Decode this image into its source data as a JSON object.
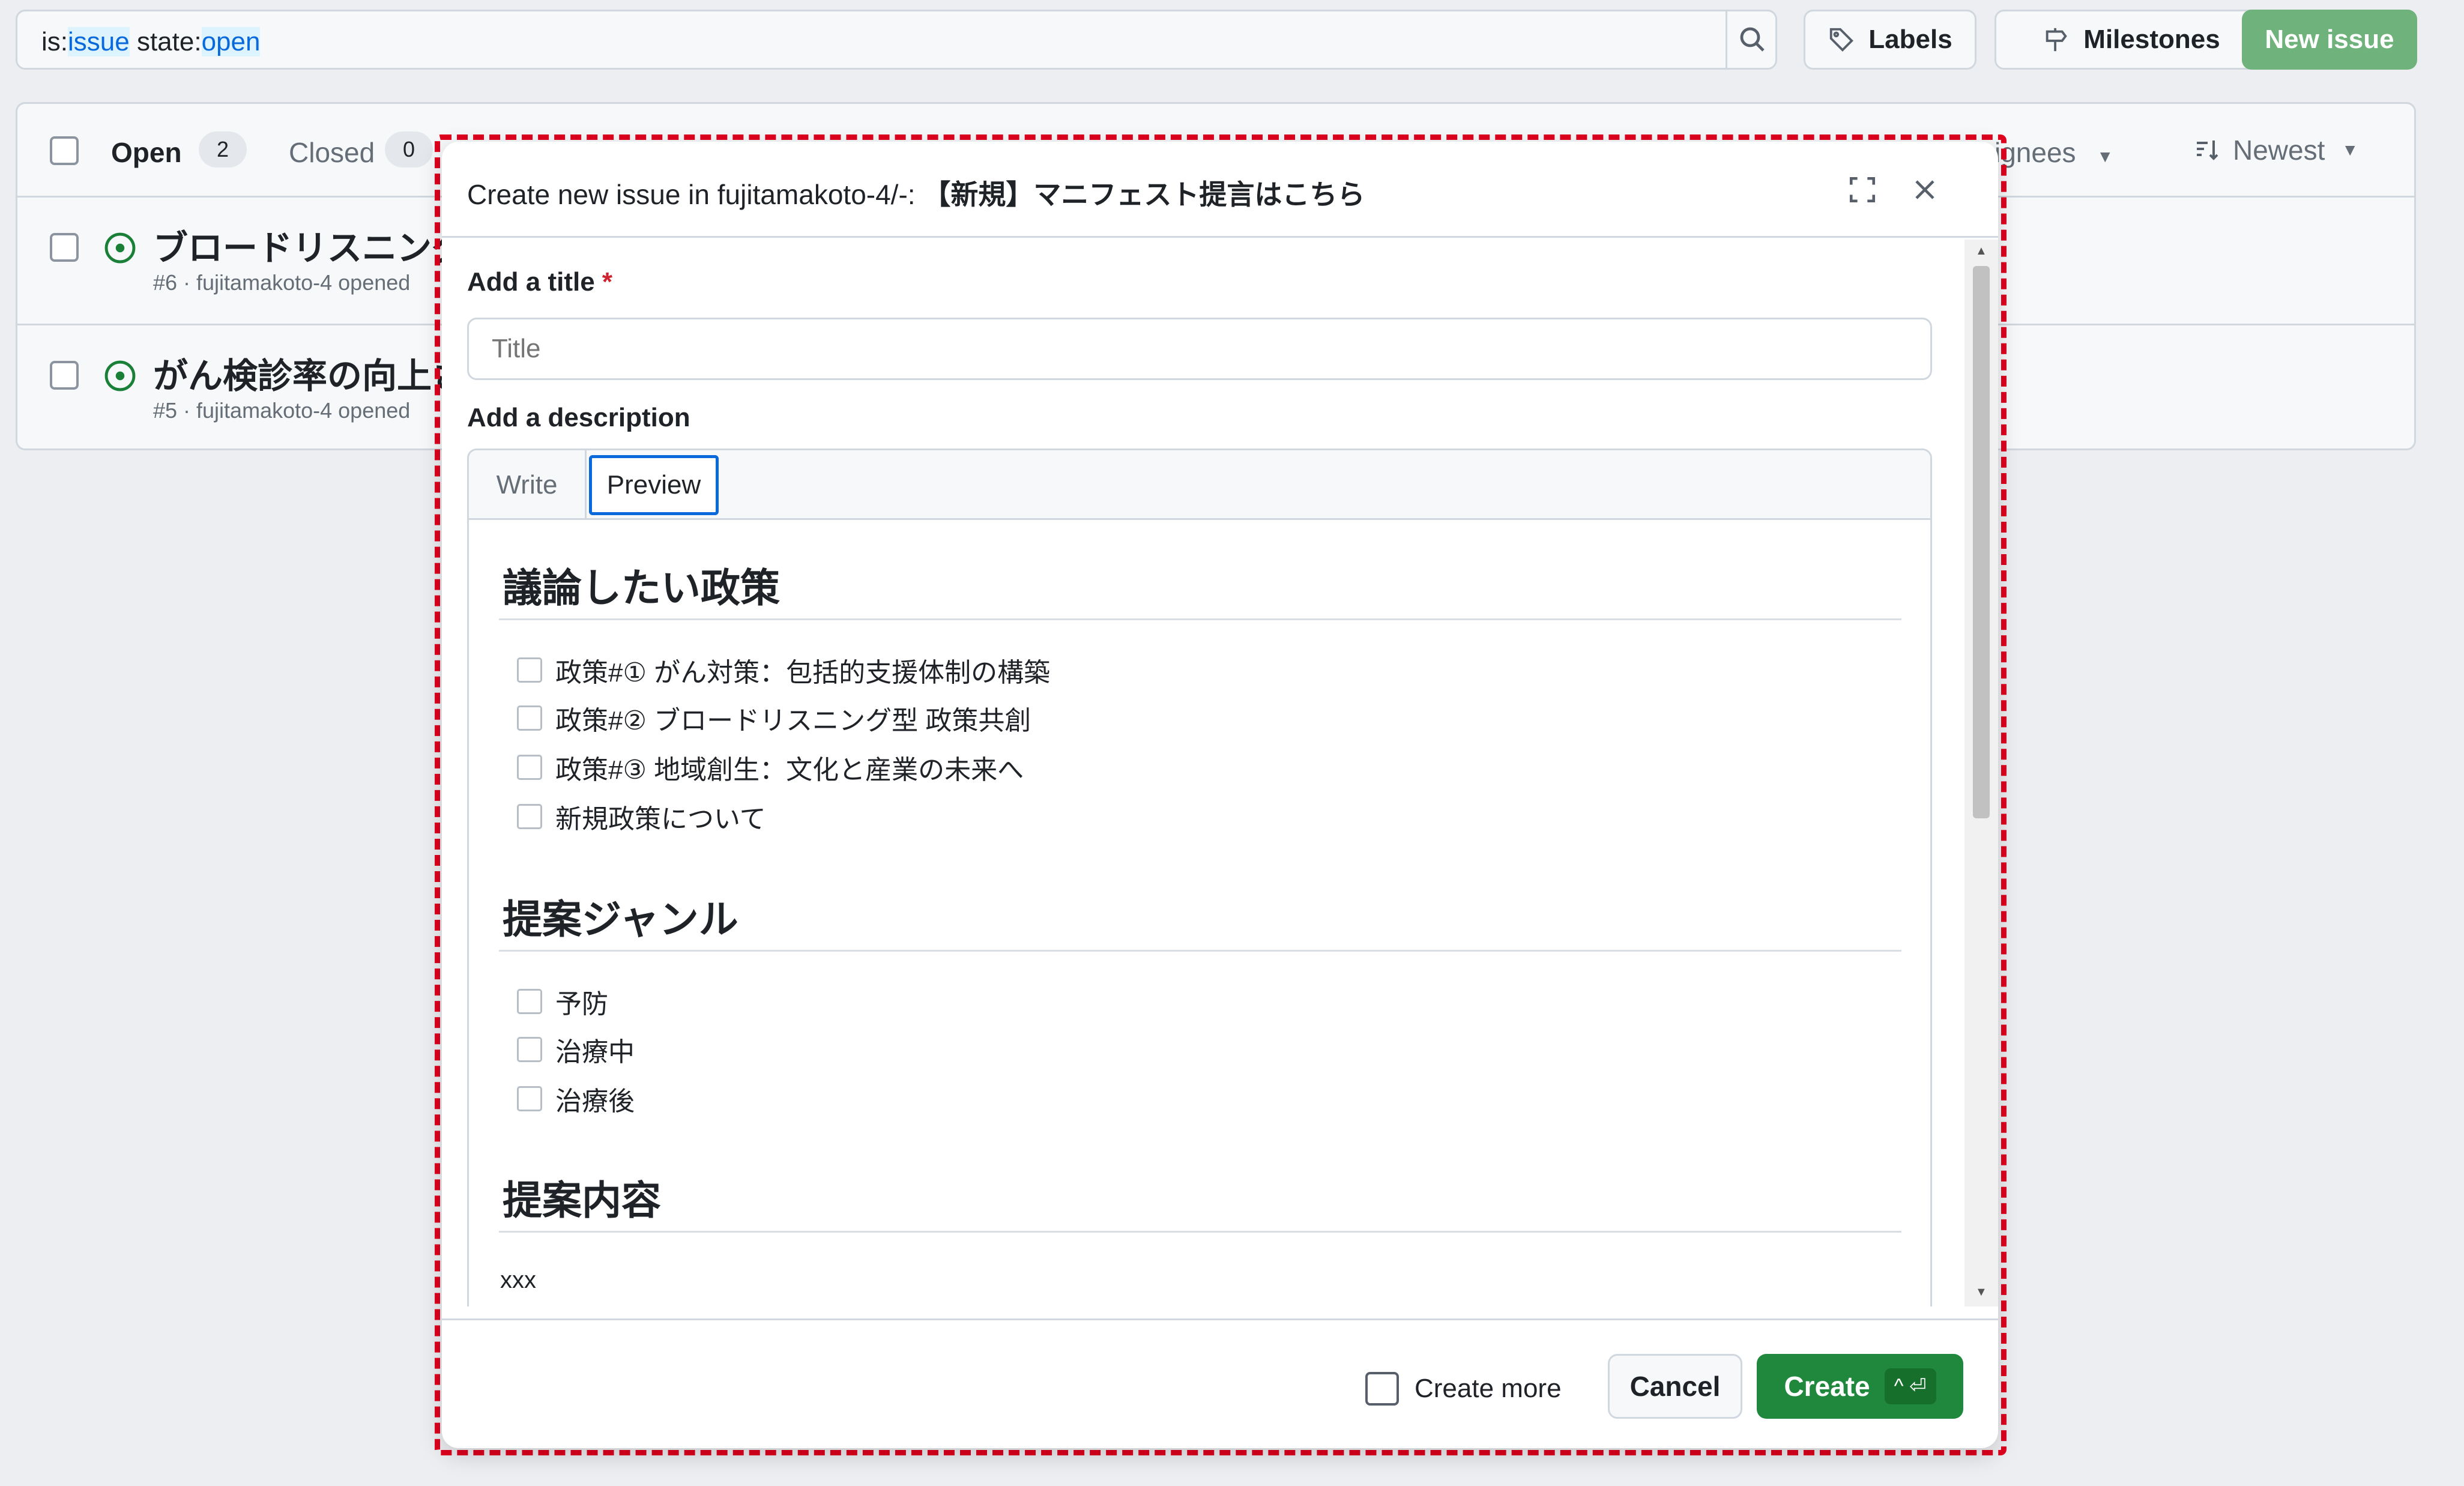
{
  "search": {
    "prefix_is": "is:",
    "value_is": "issue",
    "prefix_state": " state:",
    "value_state": "open"
  },
  "toolbar": {
    "labels": "Labels",
    "milestones": "Milestones",
    "new_issue": "New issue"
  },
  "list": {
    "open_label": "Open",
    "open_count": "2",
    "closed_label": "Closed",
    "closed_count": "0",
    "assignees_label": "signees",
    "sort_label": "Newest",
    "issues": [
      {
        "title": "ブロードリスニング",
        "meta": "#6 · fujitamakoto-4 opened"
      },
      {
        "title": "がん検診率の向上さ",
        "meta": "#5 · fujitamakoto-4 opened"
      }
    ]
  },
  "modal": {
    "title_prefix": "Create new issue in fujitamakoto-4/-: ",
    "template_name": "【新規】マニフェスト提言はこちら",
    "title_label": "Add a title",
    "required_mark": "*",
    "title_placeholder": "Title",
    "description_label": "Add a description",
    "tab_write": "Write",
    "tab_preview": "Preview",
    "preview": {
      "heading_1": "議論したい政策",
      "policies": [
        "政策#① がん対策：包括的支援体制の構築",
        "政策#② ブロードリスニング型 政策共創",
        "政策#③ 地域創生：文化と産業の未来へ",
        "新規政策について"
      ],
      "heading_2": "提案ジャンル",
      "genres": [
        "予防",
        "治療中",
        "治療後"
      ],
      "heading_3": "提案内容",
      "content": "xxx"
    },
    "footer": {
      "create_more": "Create more",
      "cancel": "Cancel",
      "create": "Create",
      "shortcut": "^ ⏎"
    }
  }
}
